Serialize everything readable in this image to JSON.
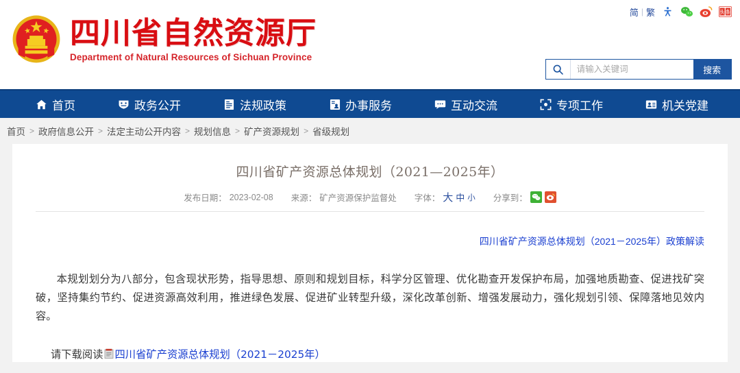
{
  "header": {
    "lang": {
      "simplified": "简",
      "separator": "|",
      "traditional": "繁"
    },
    "util_icons": [
      "accessibility-icon",
      "wechat-icon",
      "weibo-icon",
      "toutiao-icon"
    ],
    "logo_cn": "四川省自然资源厅",
    "logo_en": "Department of Natural Resources of Sichuan Province",
    "emblem": "national-emblem-icon",
    "colors": {
      "brand_red": "#d90d12",
      "nav_blue": "#0f4a92",
      "link_blue": "#1a3fd0"
    }
  },
  "search": {
    "placeholder": "请输入关键词",
    "value": "",
    "button_label": "搜索",
    "icon": "search-icon"
  },
  "nav": {
    "items": [
      {
        "label": "首页",
        "icon": "home-icon"
      },
      {
        "label": "政务公开",
        "icon": "shield-icon"
      },
      {
        "label": "法规政策",
        "icon": "document-icon"
      },
      {
        "label": "办事服务",
        "icon": "clipboard-user-icon"
      },
      {
        "label": "互动交流",
        "icon": "chat-icon"
      },
      {
        "label": "专项工作",
        "icon": "target-icon"
      },
      {
        "label": "机关党建",
        "icon": "id-card-icon"
      }
    ]
  },
  "breadcrumb": {
    "separator": ">",
    "items": [
      "首页",
      "政府信息公开",
      "法定主动公开内容",
      "规划信息",
      "矿产资源规划",
      "省级规划"
    ]
  },
  "article": {
    "title": "四川省矿产资源总体规划（2021—2025年）",
    "meta": {
      "date_label": "发布日期：",
      "date_value": "2023-02-08",
      "source_label": "来源：",
      "source_value": "矿产资源保护监督处",
      "font_label": "字体：",
      "font_sizes": [
        "大",
        "中",
        "小"
      ],
      "share_label": "分享到：",
      "share_icons": [
        "wechat-share-icon",
        "weibo-share-icon"
      ]
    },
    "interpretation_link": "四川省矿产资源总体规划（2021－2025年）政策解读",
    "body": "本规划划分为八部分，包含现状形势，指导思想、原则和规划目标，科学分区管理、优化勘查开发保护布局，加强地质勘查、促进找矿突破，坚持集约节约、促进资源高效利用，推进绿色发展、促进矿业转型升级，深化改革创新、增强发展动力，强化规划引领、保障落地见效内容。",
    "download": {
      "prefix": "请下载阅读",
      "icon": "pdf-file-icon",
      "link_text": "四川省矿产资源总体规划（2021－2025年）"
    }
  }
}
